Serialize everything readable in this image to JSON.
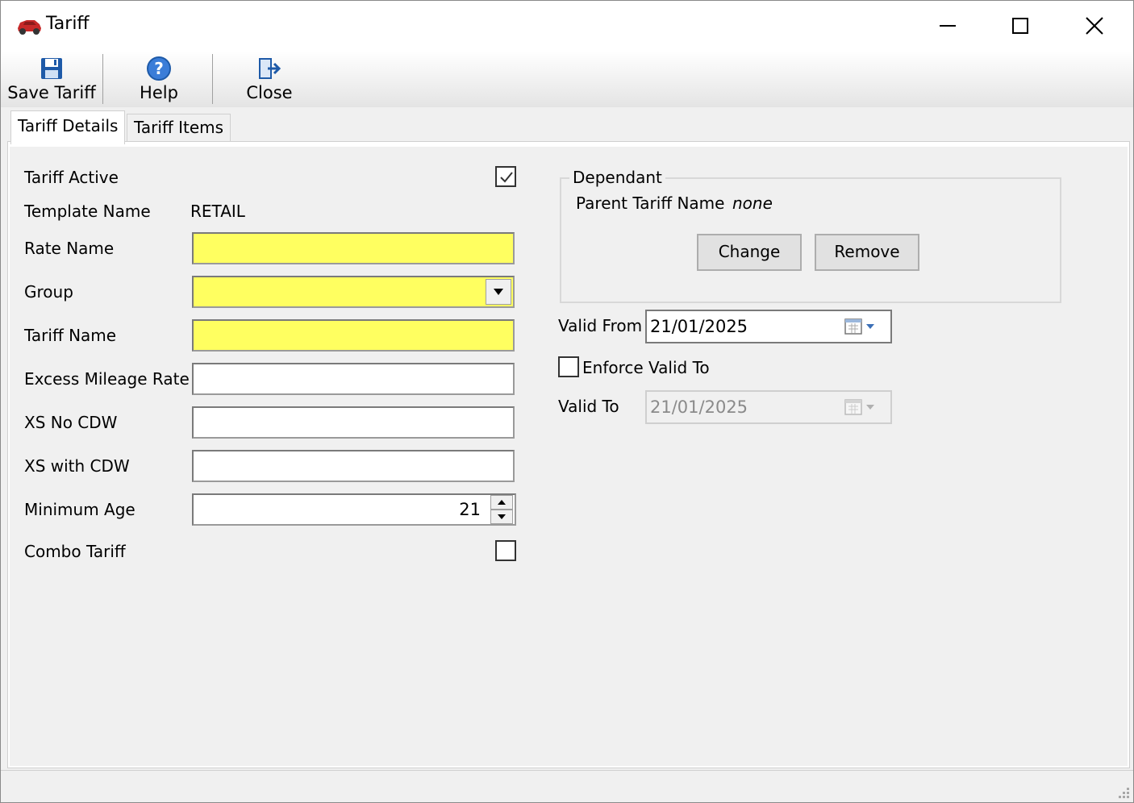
{
  "window": {
    "title": "Tariff",
    "icon": "car-icon",
    "controls": [
      "minimize-icon",
      "maximize-icon",
      "close-icon"
    ]
  },
  "toolbar": {
    "save_label": "Save Tariff",
    "help_label": "Help",
    "close_label": "Close"
  },
  "tabs": [
    {
      "label": "Tariff Details",
      "active": true
    },
    {
      "label": "Tariff Items",
      "active": false
    }
  ],
  "form": {
    "tariff_active": {
      "label": "Tariff Active",
      "checked": true
    },
    "template_name": {
      "label": "Template Name",
      "value": "RETAIL"
    },
    "rate_name": {
      "label": "Rate Name",
      "value": ""
    },
    "group": {
      "label": "Group",
      "value": ""
    },
    "tariff_name": {
      "label": "Tariff Name",
      "value": ""
    },
    "excess_mileage_rate": {
      "label": "Excess Mileage Rate",
      "value": ""
    },
    "xs_no_cdw": {
      "label": "XS No CDW",
      "value": ""
    },
    "xs_with_cdw": {
      "label": "XS with CDW",
      "value": ""
    },
    "minimum_age": {
      "label": "Minimum Age",
      "value": "21"
    },
    "combo_tariff": {
      "label": "Combo Tariff",
      "checked": false
    }
  },
  "dependant": {
    "title": "Dependant",
    "parent_label": "Parent Tariff Name",
    "parent_value": "none",
    "change_label": "Change",
    "remove_label": "Remove"
  },
  "validity": {
    "valid_from_label": "Valid From",
    "valid_from_value": "21/01/2025",
    "enforce_label": "Enforce Valid To",
    "enforce_checked": false,
    "valid_to_label": "Valid To",
    "valid_to_value": "21/01/2025"
  },
  "colors": {
    "required_field": "#ffff60",
    "accent_blue": "#1e5aa8"
  }
}
